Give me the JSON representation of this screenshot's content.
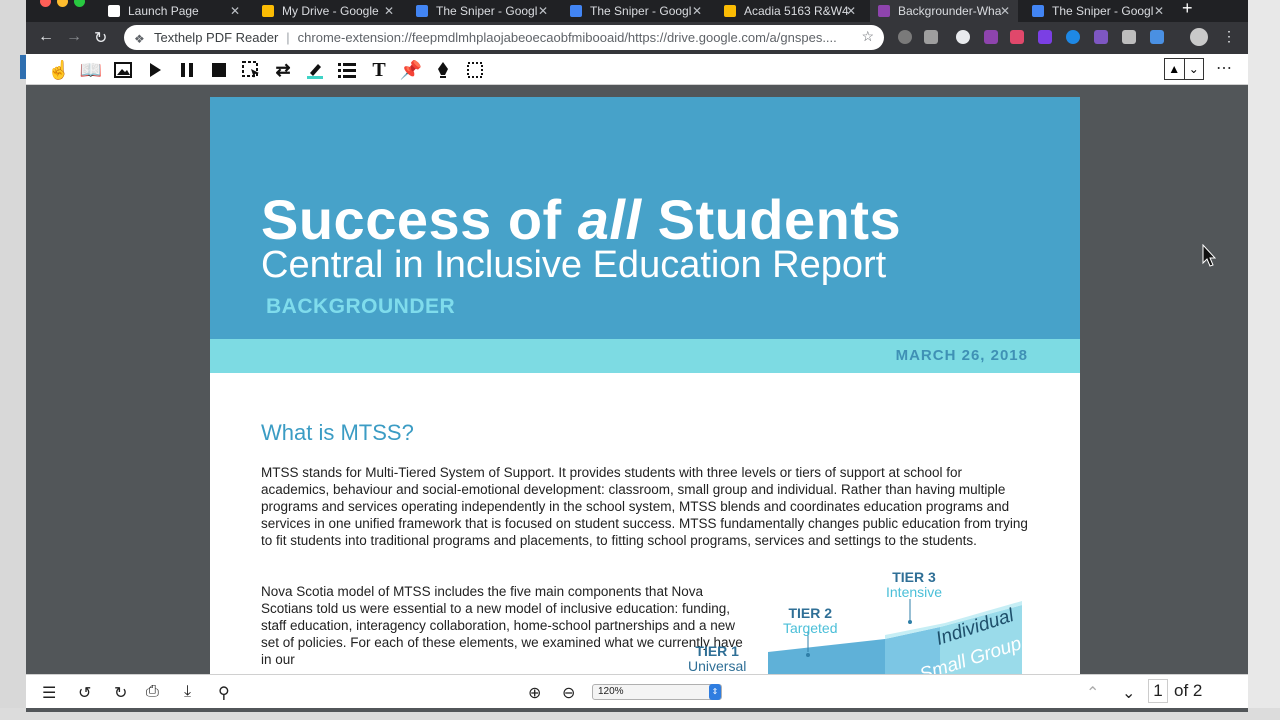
{
  "tabs": [
    {
      "title": "Launch Page",
      "icon": "launch-page-icon",
      "color": "#ffffff"
    },
    {
      "title": "My Drive - Google",
      "icon": "google-drive-icon",
      "color": "#fbbc04"
    },
    {
      "title": "The Sniper - Googl",
      "icon": "google-docs-icon",
      "color": "#4285f4"
    },
    {
      "title": "The Sniper - Googl",
      "icon": "google-docs-icon",
      "color": "#4285f4"
    },
    {
      "title": "Acadia 5163 R&W4",
      "icon": "google-drive-icon",
      "color": "#fbbc04"
    },
    {
      "title": "Backgrounder-Wha",
      "icon": "pdf-icon",
      "color": "#8e44ad",
      "active": true
    },
    {
      "title": "The Sniper - Googl",
      "icon": "google-docs-icon",
      "color": "#4285f4"
    }
  ],
  "address": {
    "app_name": "Texthelp PDF Reader",
    "url": "chrome-extension://feepmdlmhplaojabeoecaobfmibooaid/https://drive.google.com/a/gnspes...."
  },
  "toolbar_icons": [
    "hand-icon",
    "book-icon",
    "image-icon",
    "play-icon",
    "pause-icon",
    "stop-icon",
    "selection-icon",
    "shuffle-icon",
    "highlighter-icon",
    "list-icon",
    "text-icon",
    "pin-icon",
    "pen-icon",
    "crop-icon"
  ],
  "document": {
    "title_pre": "Success of ",
    "title_em": "all",
    "title_post": " Students",
    "subtitle": "Central in Inclusive Education Report",
    "kicker": "BACKGROUNDER",
    "date": "MARCH 26, 2018",
    "section_title": "What is MTSS?",
    "para1": "MTSS stands for Multi-Tiered System of Support. It provides students with three levels or tiers of support at school for academics, behaviour and social-emotional development: classroom, small group and individual. Rather than having multiple programs and services operating independently in the school system, MTSS blends and coordinates education programs and services in one unified framework that is focused on student success. MTSS fundamentally changes public education from trying to fit students into traditional programs and placements, to fitting school programs, services and settings to the students.",
    "para2": "Nova Scotia model of MTSS includes the five main components that Nova Scotians told us were essential to a new model of inclusive education: funding, staff education, interagency collaboration, home-school partnerships and a new set of policies. For each of these elements, we examined what we currently have in our",
    "tier3_label": "TIER 3",
    "tier3_sub": "Intensive",
    "tier2_label": "TIER 2",
    "tier2_sub": "Targeted",
    "tier1_label": "TIER 1",
    "tier1_sub": "Universal",
    "step_individual": "Individual",
    "step_small_group": "Small Group"
  },
  "footer": {
    "zoom": "120%",
    "page_current": "1",
    "page_total": "of 2"
  }
}
